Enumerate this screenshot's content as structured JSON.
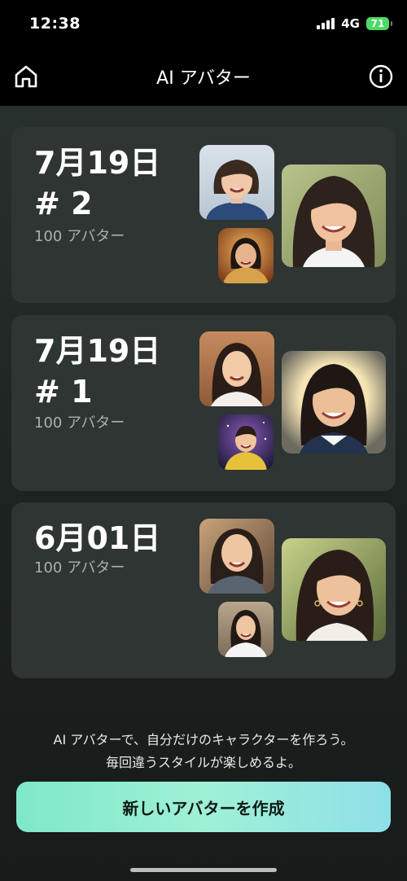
{
  "status_bar": {
    "time": "12:38",
    "network": "4G",
    "battery": "71"
  },
  "header": {
    "title": "AI アバター",
    "home_icon": "home-icon",
    "info_icon": "info-icon"
  },
  "sessions": [
    {
      "date": "7月19日",
      "number": "# 2",
      "count": "100 アバター"
    },
    {
      "date": "7月19日",
      "number": "# 1",
      "count": "100 アバター"
    },
    {
      "date": "6月01日",
      "number": "",
      "count": "100 アバター"
    }
  ],
  "footer": {
    "tagline_line1": "AI アバターで、自分だけのキャラクターを作ろう。",
    "tagline_line2": "毎回違うスタイルが楽しめるよ。",
    "create_button": "新しいアバターを作成"
  },
  "colors": {
    "accent_gradient_start": "#7ee8c7",
    "accent_gradient_end": "#8ee0e8",
    "card_bg": "#2e3532"
  }
}
